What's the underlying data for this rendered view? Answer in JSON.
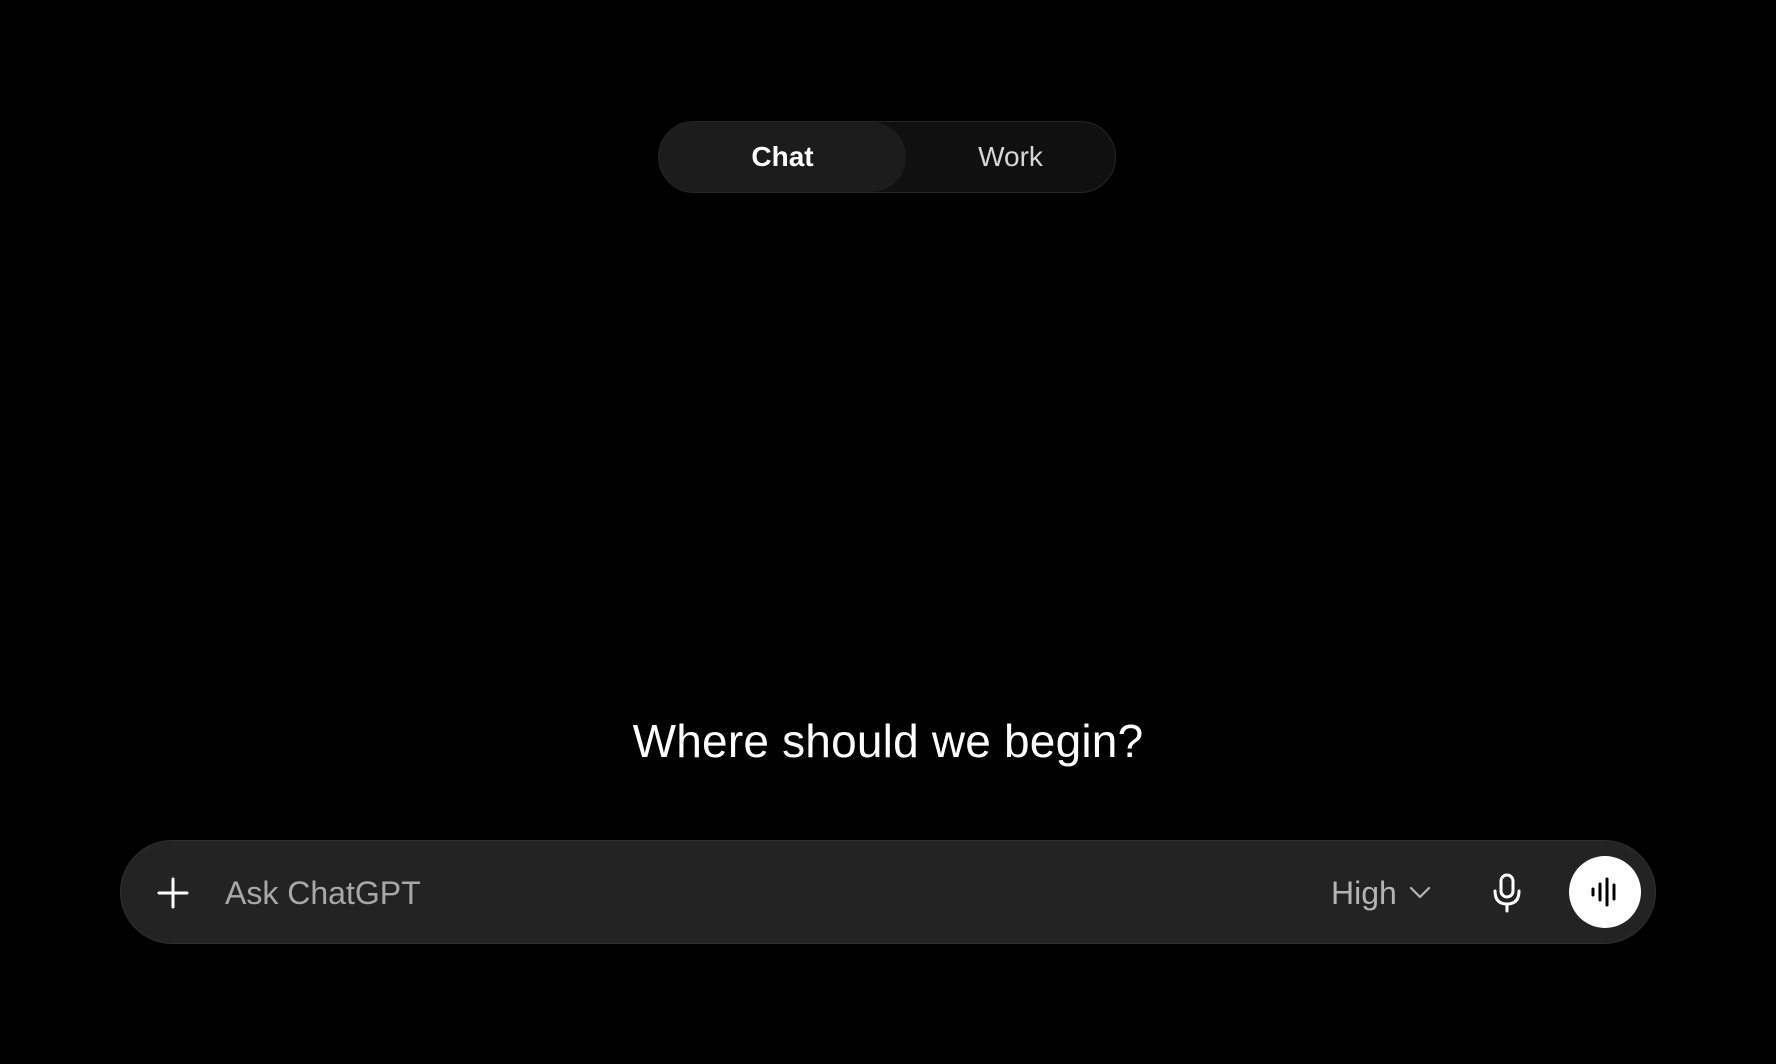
{
  "mode_toggle": {
    "tabs": [
      {
        "label": "Chat",
        "active": true
      },
      {
        "label": "Work",
        "active": false
      }
    ]
  },
  "heading": {
    "text": "Where should we begin?"
  },
  "composer": {
    "add_icon": "plus-icon",
    "input": {
      "placeholder": "Ask ChatGPT",
      "value": ""
    },
    "effort_select": {
      "value": "High",
      "icon": "chevron-down-icon"
    },
    "mic_icon": "microphone-icon",
    "voice_icon": "voice-waveform-icon"
  },
  "colors": {
    "background": "#000000",
    "composer_bg": "#232323",
    "toggle_bg": "#101010",
    "toggle_active_bg": "#1c1c1c",
    "placeholder": "#a8a8a8",
    "voice_button_bg": "#ffffff"
  }
}
